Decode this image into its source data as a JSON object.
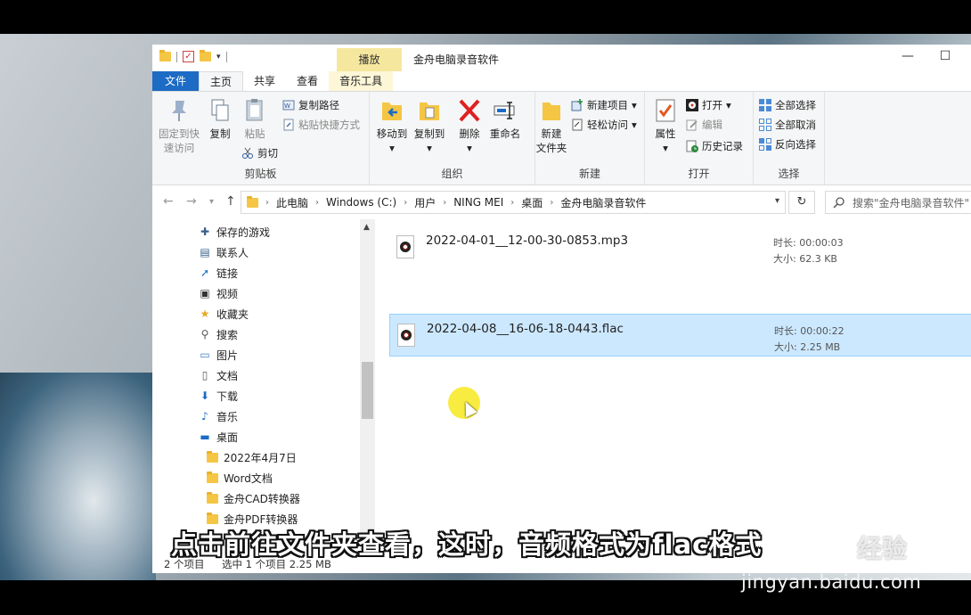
{
  "window": {
    "title": "金舟电脑录音软件",
    "context_tab": "播放",
    "minimize": "—",
    "maximize": "☐"
  },
  "tabs": [
    "文件",
    "主页",
    "共享",
    "查看",
    "音乐工具"
  ],
  "ribbon": {
    "clipboard": {
      "label": "剪贴板",
      "pin_line1": "固定到快",
      "pin_line2": "速访问",
      "copy": "复制",
      "paste": "粘贴",
      "copy_path": "复制路径",
      "paste_shortcut": "粘贴快捷方式",
      "cut": "剪切"
    },
    "organize": {
      "label": "组织",
      "move_to": "移动到",
      "copy_to": "复制到",
      "delete": "删除",
      "rename": "重命名"
    },
    "new": {
      "label": "新建",
      "new_folder_line1": "新建",
      "new_folder_line2": "文件夹",
      "new_item": "新建项目",
      "easy_access": "轻松访问"
    },
    "open": {
      "label": "打开",
      "properties": "属性",
      "open": "打开",
      "edit": "编辑",
      "history": "历史记录"
    },
    "select": {
      "label": "选择",
      "select_all": "全部选择",
      "select_none": "全部取消",
      "invert": "反向选择"
    }
  },
  "address": {
    "crumbs": [
      "此电脑",
      "Windows (C:)",
      "用户",
      "NING MEI",
      "桌面",
      "金舟电脑录音软件"
    ],
    "search_placeholder": "搜索\"金舟电脑录音软件\""
  },
  "nav": [
    {
      "label": "保存的游戏",
      "icon": "saved-games-icon"
    },
    {
      "label": "联系人",
      "icon": "contacts-icon"
    },
    {
      "label": "链接",
      "icon": "links-icon"
    },
    {
      "label": "视频",
      "icon": "videos-icon"
    },
    {
      "label": "收藏夹",
      "icon": "favorites-icon"
    },
    {
      "label": "搜索",
      "icon": "search-icon"
    },
    {
      "label": "图片",
      "icon": "pictures-icon"
    },
    {
      "label": "文档",
      "icon": "documents-icon"
    },
    {
      "label": "下载",
      "icon": "downloads-icon"
    },
    {
      "label": "音乐",
      "icon": "music-icon"
    },
    {
      "label": "桌面",
      "icon": "desktop-icon"
    },
    {
      "label": "2022年4月7日",
      "icon": "folder-icon"
    },
    {
      "label": "Word文档",
      "icon": "folder-icon"
    },
    {
      "label": "金舟CAD转换器",
      "icon": "folder-icon"
    },
    {
      "label": "金舟PDF转换器",
      "icon": "folder-icon"
    }
  ],
  "files": [
    {
      "name": "2022-04-01__12-00-30-0853.mp3",
      "duration": "时长: 00:00:03",
      "size": "大小: 62.3 KB",
      "selected": false
    },
    {
      "name": "2022-04-08__16-06-18-0443.flac",
      "duration": "时长: 00:00:22",
      "size": "大小: 2.25 MB",
      "selected": true
    }
  ],
  "status": {
    "count": "2 个项目",
    "selection": "选中 1 个项目  2.25 MB"
  },
  "subtitle": "点击前往文件夹查看，这时，音频格式为flac格式",
  "watermark": {
    "text": "经验",
    "url": "jingyan.baidu.com"
  },
  "colors": {
    "file_tab": "#1c6bc4",
    "context_tab": "#f6e79e",
    "selection": "#cce8ff"
  }
}
